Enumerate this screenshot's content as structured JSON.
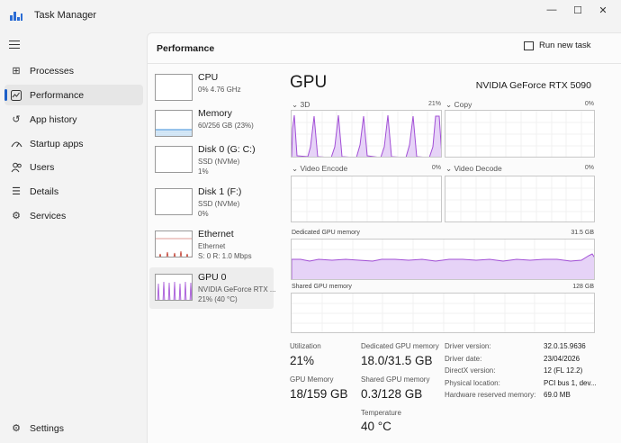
{
  "window": {
    "title": "Task Manager",
    "minimize": "—",
    "maximize": "☐",
    "close": "✕"
  },
  "nav": {
    "items": [
      {
        "label": "Processes",
        "icon": "processes-icon",
        "glyph": "⊞"
      },
      {
        "label": "Performance",
        "icon": "performance-icon",
        "glyph": "⌁"
      },
      {
        "label": "App history",
        "icon": "history-icon",
        "glyph": "↺"
      },
      {
        "label": "Startup apps",
        "icon": "startup-icon",
        "glyph": "⚲"
      },
      {
        "label": "Users",
        "icon": "users-icon",
        "glyph": "⚇"
      },
      {
        "label": "Details",
        "icon": "details-icon",
        "glyph": "☰"
      },
      {
        "label": "Services",
        "icon": "services-icon",
        "glyph": "⚙"
      }
    ],
    "settings": {
      "label": "Settings",
      "glyph": "⚙"
    }
  },
  "header": {
    "title": "Performance",
    "run_new_task": "Run new task"
  },
  "devices": [
    {
      "name": "CPU",
      "sub1": "0% 4.76 GHz",
      "sub2": "",
      "sub3": ""
    },
    {
      "name": "Memory",
      "sub1": "60/256 GB (23%)",
      "sub2": "",
      "sub3": ""
    },
    {
      "name": "Disk 0 (G: C:)",
      "sub1": "SSD (NVMe)",
      "sub2": "1%",
      "sub3": ""
    },
    {
      "name": "Disk 1 (F:)",
      "sub1": "SSD (NVMe)",
      "sub2": "0%",
      "sub3": ""
    },
    {
      "name": "Ethernet",
      "sub1": "Ethernet",
      "sub2": "S: 0 R: 1.0 Mbps",
      "sub3": ""
    },
    {
      "name": "GPU 0",
      "sub1": "NVIDIA GeForce RTX ...",
      "sub2": "21% (40 °C)",
      "sub3": ""
    }
  ],
  "gpu": {
    "title": "GPU",
    "model": "NVIDIA GeForce RTX 5090",
    "engines": [
      {
        "label": "3D",
        "pct": "21%"
      },
      {
        "label": "Copy",
        "pct": "0%"
      },
      {
        "label": "Video Encode",
        "pct": "0%"
      },
      {
        "label": "Video Decode",
        "pct": "0%"
      }
    ],
    "dedicated_label": "Dedicated GPU memory",
    "dedicated_max": "31.5 GB",
    "shared_label": "Shared GPU memory",
    "shared_max": "128 GB",
    "stats": {
      "utilization_label": "Utilization",
      "utilization": "21%",
      "dedicated_label": "Dedicated GPU memory",
      "dedicated": "18.0/31.5 GB",
      "gpu_memory_label": "GPU Memory",
      "gpu_memory": "18/159 GB",
      "shared_label": "Shared GPU memory",
      "shared": "0.3/128 GB",
      "temperature_label": "Temperature",
      "temperature": "40 °C"
    },
    "info": [
      {
        "label": "Driver version:",
        "value": "32.0.15.9636"
      },
      {
        "label": "Driver date:",
        "value": "23/04/2026"
      },
      {
        "label": "DirectX version:",
        "value": "12 (FL 12.2)"
      },
      {
        "label": "Physical location:",
        "value": "PCI bus 1, dev..."
      },
      {
        "label": "Hardware reserved memory:",
        "value": "69.0 MB"
      }
    ]
  },
  "colors": {
    "gpu_accent": "#a24fd6",
    "gpu_fill": "#e6d3f7",
    "memory_accent": "#3b8ed8",
    "ethernet_accent": "#c0392b",
    "nav_active": "#1c5fc7"
  }
}
